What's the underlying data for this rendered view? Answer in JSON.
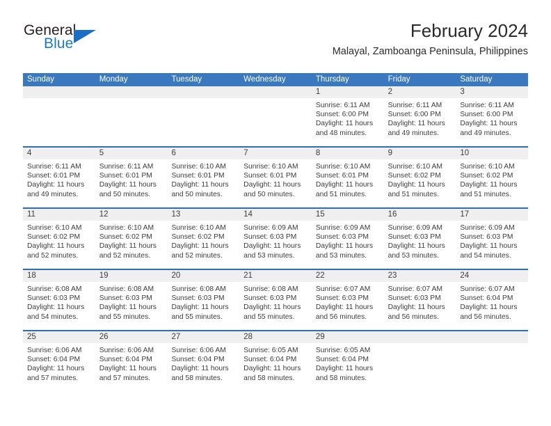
{
  "brand": {
    "name_part1": "General",
    "name_part2": "Blue",
    "flag_icon": "triangle-flag-icon"
  },
  "header": {
    "title": "February 2024",
    "subtitle": "Malayal, Zamboanga Peninsula, Philippines"
  },
  "weekdays": [
    "Sunday",
    "Monday",
    "Tuesday",
    "Wednesday",
    "Thursday",
    "Friday",
    "Saturday"
  ],
  "colors": {
    "header_blue": "#3a78bf",
    "separator_blue": "#2f6fb0",
    "day_band_gray": "#efefef",
    "brand_blue": "#1b7ac4",
    "text": "#3c3c3c"
  },
  "weeks": [
    [
      {
        "day": "",
        "sunrise": "",
        "sunset": "",
        "daylight_line1": "",
        "daylight_line2": ""
      },
      {
        "day": "",
        "sunrise": "",
        "sunset": "",
        "daylight_line1": "",
        "daylight_line2": ""
      },
      {
        "day": "",
        "sunrise": "",
        "sunset": "",
        "daylight_line1": "",
        "daylight_line2": ""
      },
      {
        "day": "",
        "sunrise": "",
        "sunset": "",
        "daylight_line1": "",
        "daylight_line2": ""
      },
      {
        "day": "1",
        "sunrise": "Sunrise: 6:11 AM",
        "sunset": "Sunset: 6:00 PM",
        "daylight_line1": "Daylight: 11 hours",
        "daylight_line2": "and 48 minutes."
      },
      {
        "day": "2",
        "sunrise": "Sunrise: 6:11 AM",
        "sunset": "Sunset: 6:00 PM",
        "daylight_line1": "Daylight: 11 hours",
        "daylight_line2": "and 49 minutes."
      },
      {
        "day": "3",
        "sunrise": "Sunrise: 6:11 AM",
        "sunset": "Sunset: 6:00 PM",
        "daylight_line1": "Daylight: 11 hours",
        "daylight_line2": "and 49 minutes."
      }
    ],
    [
      {
        "day": "4",
        "sunrise": "Sunrise: 6:11 AM",
        "sunset": "Sunset: 6:01 PM",
        "daylight_line1": "Daylight: 11 hours",
        "daylight_line2": "and 49 minutes."
      },
      {
        "day": "5",
        "sunrise": "Sunrise: 6:11 AM",
        "sunset": "Sunset: 6:01 PM",
        "daylight_line1": "Daylight: 11 hours",
        "daylight_line2": "and 50 minutes."
      },
      {
        "day": "6",
        "sunrise": "Sunrise: 6:10 AM",
        "sunset": "Sunset: 6:01 PM",
        "daylight_line1": "Daylight: 11 hours",
        "daylight_line2": "and 50 minutes."
      },
      {
        "day": "7",
        "sunrise": "Sunrise: 6:10 AM",
        "sunset": "Sunset: 6:01 PM",
        "daylight_line1": "Daylight: 11 hours",
        "daylight_line2": "and 50 minutes."
      },
      {
        "day": "8",
        "sunrise": "Sunrise: 6:10 AM",
        "sunset": "Sunset: 6:01 PM",
        "daylight_line1": "Daylight: 11 hours",
        "daylight_line2": "and 51 minutes."
      },
      {
        "day": "9",
        "sunrise": "Sunrise: 6:10 AM",
        "sunset": "Sunset: 6:02 PM",
        "daylight_line1": "Daylight: 11 hours",
        "daylight_line2": "and 51 minutes."
      },
      {
        "day": "10",
        "sunrise": "Sunrise: 6:10 AM",
        "sunset": "Sunset: 6:02 PM",
        "daylight_line1": "Daylight: 11 hours",
        "daylight_line2": "and 51 minutes."
      }
    ],
    [
      {
        "day": "11",
        "sunrise": "Sunrise: 6:10 AM",
        "sunset": "Sunset: 6:02 PM",
        "daylight_line1": "Daylight: 11 hours",
        "daylight_line2": "and 52 minutes."
      },
      {
        "day": "12",
        "sunrise": "Sunrise: 6:10 AM",
        "sunset": "Sunset: 6:02 PM",
        "daylight_line1": "Daylight: 11 hours",
        "daylight_line2": "and 52 minutes."
      },
      {
        "day": "13",
        "sunrise": "Sunrise: 6:10 AM",
        "sunset": "Sunset: 6:02 PM",
        "daylight_line1": "Daylight: 11 hours",
        "daylight_line2": "and 52 minutes."
      },
      {
        "day": "14",
        "sunrise": "Sunrise: 6:09 AM",
        "sunset": "Sunset: 6:03 PM",
        "daylight_line1": "Daylight: 11 hours",
        "daylight_line2": "and 53 minutes."
      },
      {
        "day": "15",
        "sunrise": "Sunrise: 6:09 AM",
        "sunset": "Sunset: 6:03 PM",
        "daylight_line1": "Daylight: 11 hours",
        "daylight_line2": "and 53 minutes."
      },
      {
        "day": "16",
        "sunrise": "Sunrise: 6:09 AM",
        "sunset": "Sunset: 6:03 PM",
        "daylight_line1": "Daylight: 11 hours",
        "daylight_line2": "and 53 minutes."
      },
      {
        "day": "17",
        "sunrise": "Sunrise: 6:09 AM",
        "sunset": "Sunset: 6:03 PM",
        "daylight_line1": "Daylight: 11 hours",
        "daylight_line2": "and 54 minutes."
      }
    ],
    [
      {
        "day": "18",
        "sunrise": "Sunrise: 6:08 AM",
        "sunset": "Sunset: 6:03 PM",
        "daylight_line1": "Daylight: 11 hours",
        "daylight_line2": "and 54 minutes."
      },
      {
        "day": "19",
        "sunrise": "Sunrise: 6:08 AM",
        "sunset": "Sunset: 6:03 PM",
        "daylight_line1": "Daylight: 11 hours",
        "daylight_line2": "and 55 minutes."
      },
      {
        "day": "20",
        "sunrise": "Sunrise: 6:08 AM",
        "sunset": "Sunset: 6:03 PM",
        "daylight_line1": "Daylight: 11 hours",
        "daylight_line2": "and 55 minutes."
      },
      {
        "day": "21",
        "sunrise": "Sunrise: 6:08 AM",
        "sunset": "Sunset: 6:03 PM",
        "daylight_line1": "Daylight: 11 hours",
        "daylight_line2": "and 55 minutes."
      },
      {
        "day": "22",
        "sunrise": "Sunrise: 6:07 AM",
        "sunset": "Sunset: 6:03 PM",
        "daylight_line1": "Daylight: 11 hours",
        "daylight_line2": "and 56 minutes."
      },
      {
        "day": "23",
        "sunrise": "Sunrise: 6:07 AM",
        "sunset": "Sunset: 6:03 PM",
        "daylight_line1": "Daylight: 11 hours",
        "daylight_line2": "and 56 minutes."
      },
      {
        "day": "24",
        "sunrise": "Sunrise: 6:07 AM",
        "sunset": "Sunset: 6:04 PM",
        "daylight_line1": "Daylight: 11 hours",
        "daylight_line2": "and 56 minutes."
      }
    ],
    [
      {
        "day": "25",
        "sunrise": "Sunrise: 6:06 AM",
        "sunset": "Sunset: 6:04 PM",
        "daylight_line1": "Daylight: 11 hours",
        "daylight_line2": "and 57 minutes."
      },
      {
        "day": "26",
        "sunrise": "Sunrise: 6:06 AM",
        "sunset": "Sunset: 6:04 PM",
        "daylight_line1": "Daylight: 11 hours",
        "daylight_line2": "and 57 minutes."
      },
      {
        "day": "27",
        "sunrise": "Sunrise: 6:06 AM",
        "sunset": "Sunset: 6:04 PM",
        "daylight_line1": "Daylight: 11 hours",
        "daylight_line2": "and 58 minutes."
      },
      {
        "day": "28",
        "sunrise": "Sunrise: 6:05 AM",
        "sunset": "Sunset: 6:04 PM",
        "daylight_line1": "Daylight: 11 hours",
        "daylight_line2": "and 58 minutes."
      },
      {
        "day": "29",
        "sunrise": "Sunrise: 6:05 AM",
        "sunset": "Sunset: 6:04 PM",
        "daylight_line1": "Daylight: 11 hours",
        "daylight_line2": "and 58 minutes."
      },
      {
        "day": "",
        "sunrise": "",
        "sunset": "",
        "daylight_line1": "",
        "daylight_line2": ""
      },
      {
        "day": "",
        "sunrise": "",
        "sunset": "",
        "daylight_line1": "",
        "daylight_line2": ""
      }
    ]
  ]
}
